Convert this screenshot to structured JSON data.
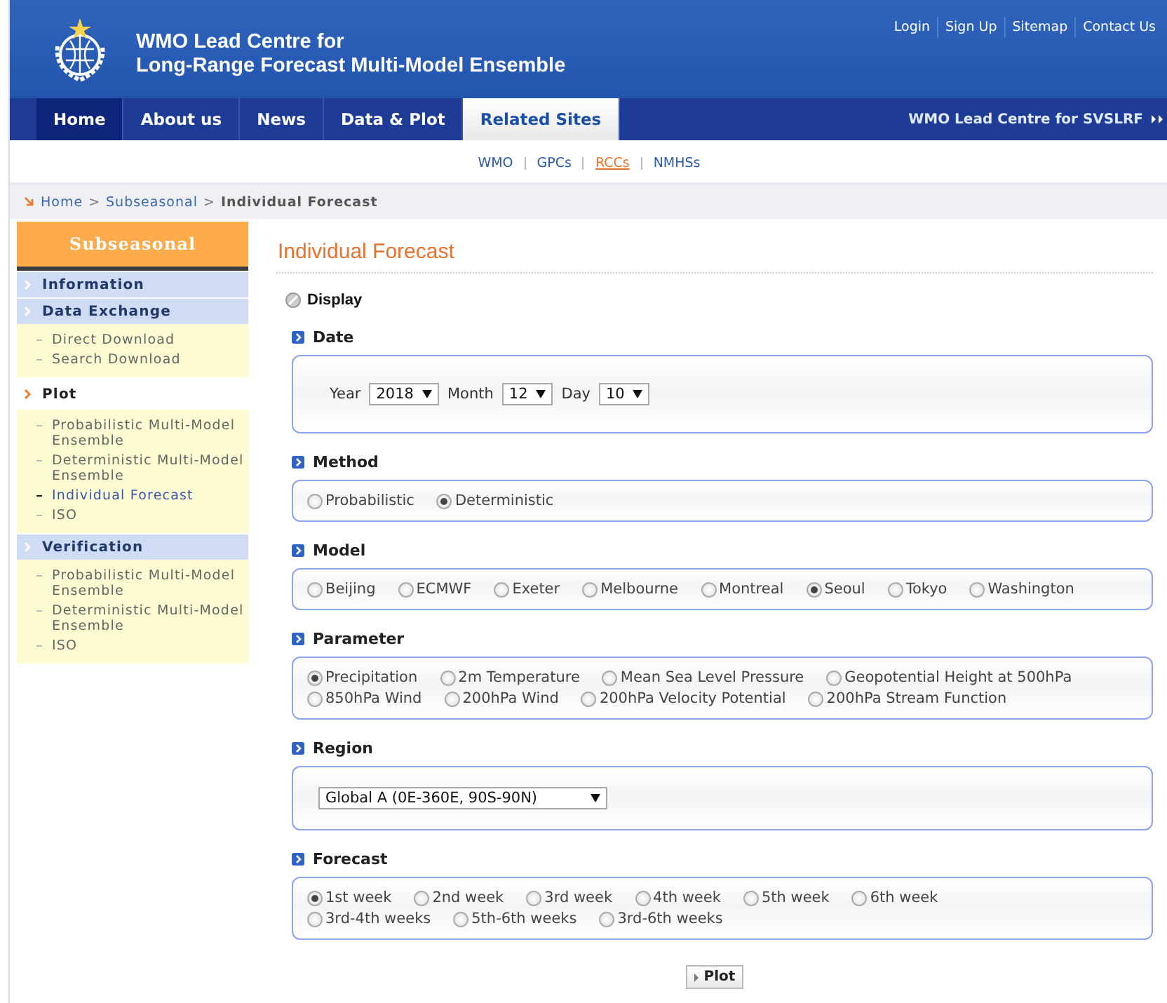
{
  "header": {
    "title_lines": [
      "WMO Lead Centre for",
      "Long-Range Forecast Multi-Model Ensemble"
    ],
    "top_links": [
      "Login",
      "Sign Up",
      "Sitemap",
      "Contact Us"
    ]
  },
  "nav": {
    "tabs": [
      {
        "label": "Home",
        "selected": false,
        "current": true
      },
      {
        "label": "About us",
        "selected": false,
        "current": false
      },
      {
        "label": "News",
        "selected": false,
        "current": false
      },
      {
        "label": "Data & Plot",
        "selected": false,
        "current": false
      },
      {
        "label": "Related Sites",
        "selected": true,
        "current": false
      }
    ],
    "right_link": "WMO Lead Centre for SVSLRF"
  },
  "sub_links": [
    {
      "label": "WMO",
      "selected": false
    },
    {
      "label": "GPCs",
      "selected": false
    },
    {
      "label": "RCCs",
      "selected": true
    },
    {
      "label": "NMHSs",
      "selected": false
    }
  ],
  "breadcrumb": {
    "items": [
      "Home",
      "Subseasonal",
      "Individual Forecast"
    ],
    "separator": ">"
  },
  "sidebar": {
    "title": "Subseasonal",
    "groups": [
      {
        "label": "Information",
        "selected": false
      },
      {
        "label": "Data Exchange",
        "selected": false,
        "items": [
          {
            "label": "Direct Download",
            "selected": false
          },
          {
            "label": "Search Download",
            "selected": false
          }
        ]
      },
      {
        "label": "Plot",
        "selected": true,
        "items": [
          {
            "label": "Probabilistic Multi-Model Ensemble",
            "selected": false
          },
          {
            "label": "Deterministic Multi-Model Ensemble",
            "selected": false
          },
          {
            "label": "Individual Forecast",
            "selected": true
          },
          {
            "label": "ISO",
            "selected": false
          }
        ]
      },
      {
        "label": "Verification",
        "selected": false,
        "items": [
          {
            "label": "Probabilistic Multi-Model Ensemble",
            "selected": false
          },
          {
            "label": "Deterministic Multi-Model Ensemble",
            "selected": false
          },
          {
            "label": "ISO",
            "selected": false
          }
        ]
      }
    ]
  },
  "main": {
    "title": "Individual Forecast",
    "display_label": "Display",
    "sections": [
      {
        "heading": "Date",
        "kind": "selects",
        "fields": [
          {
            "label": "Year",
            "value": "2018"
          },
          {
            "label": "Month",
            "value": "12"
          },
          {
            "label": "Day",
            "value": "10"
          }
        ]
      },
      {
        "heading": "Method",
        "kind": "radios",
        "rows": [
          {
            "options": [
              {
                "label": "Probabilistic",
                "selected": false
              },
              {
                "label": "Deterministic",
                "selected": true
              }
            ]
          }
        ]
      },
      {
        "heading": "Model",
        "kind": "radios",
        "rows": [
          {
            "options": [
              {
                "label": "Beijing",
                "selected": false
              },
              {
                "label": "ECMWF",
                "selected": false
              },
              {
                "label": "Exeter",
                "selected": false
              },
              {
                "label": "Melbourne",
                "selected": false
              },
              {
                "label": "Montreal",
                "selected": false
              },
              {
                "label": "Seoul",
                "selected": true
              },
              {
                "label": "Tokyo",
                "selected": false
              },
              {
                "label": "Washington",
                "selected": false
              }
            ]
          }
        ]
      },
      {
        "heading": "Parameter",
        "kind": "radios",
        "rows": [
          {
            "options": [
              {
                "label": "Precipitation",
                "selected": true
              },
              {
                "label": "2m Temperature",
                "selected": false
              },
              {
                "label": "Mean Sea Level Pressure",
                "selected": false
              },
              {
                "label": "Geopotential Height at 500hPa",
                "selected": false
              }
            ]
          },
          {
            "options": [
              {
                "label": "850hPa Wind",
                "selected": false
              },
              {
                "label": "200hPa Wind",
                "selected": false
              },
              {
                "label": "200hPa Velocity Potential",
                "selected": false
              },
              {
                "label": "200hPa Stream Function",
                "selected": false
              }
            ]
          }
        ]
      },
      {
        "heading": "Region",
        "kind": "select",
        "value": "Global A (0E-360E, 90S-90N)"
      },
      {
        "heading": "Forecast",
        "kind": "radios",
        "rows": [
          {
            "options": [
              {
                "label": "1st week",
                "selected": true
              },
              {
                "label": "2nd week",
                "selected": false
              },
              {
                "label": "3rd week",
                "selected": false
              },
              {
                "label": "4th week",
                "selected": false
              },
              {
                "label": "5th week",
                "selected": false
              },
              {
                "label": "6th week",
                "selected": false
              }
            ]
          },
          {
            "options": [
              {
                "label": "3rd-4th weeks",
                "selected": false
              },
              {
                "label": "5th-6th weeks",
                "selected": false
              },
              {
                "label": "3rd-6th weeks",
                "selected": false
              }
            ]
          }
        ]
      }
    ],
    "button": "Plot"
  }
}
